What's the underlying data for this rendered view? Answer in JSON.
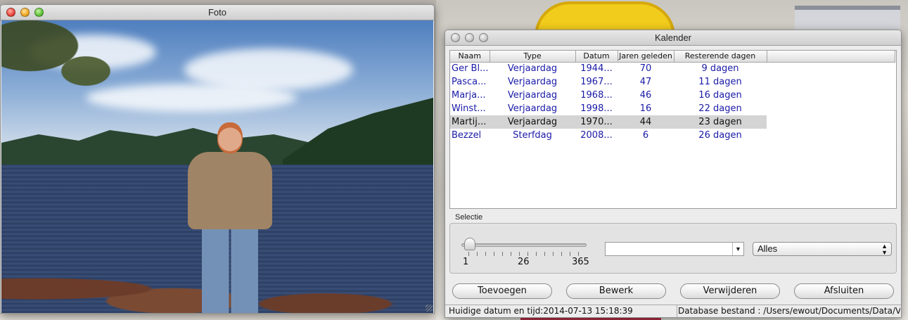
{
  "photo_window": {
    "title": "Foto"
  },
  "calendar_window": {
    "title": "Kalender",
    "columns": [
      "Naam",
      "Type",
      "Datum",
      "Jaren geleden",
      "Resterende dagen"
    ],
    "rows": [
      {
        "naam": "Ger Bl...",
        "type": "Verjaardag",
        "datum": "1944...",
        "jaren": "70",
        "rest": "9 dagen"
      },
      {
        "naam": "Pasca...",
        "type": "Verjaardag",
        "datum": "1967...",
        "jaren": "47",
        "rest": "11 dagen"
      },
      {
        "naam": "Marja...",
        "type": "Verjaardag",
        "datum": "1968...",
        "jaren": "46",
        "rest": "16 dagen"
      },
      {
        "naam": "Winst...",
        "type": "Verjaardag",
        "datum": "1998...",
        "jaren": "16",
        "rest": "22 dagen"
      },
      {
        "naam": "Martij...",
        "type": "Verjaardag",
        "datum": "1970...",
        "jaren": "44",
        "rest": "23 dagen"
      },
      {
        "naam": "Bezzel",
        "type": "Sterfdag",
        "datum": "2008...",
        "jaren": "6",
        "rest": "26 dagen"
      }
    ],
    "selected_row": 4,
    "selection": {
      "label": "Selectie",
      "slider_labels": [
        "1",
        "26",
        "365"
      ],
      "slider_value": 26,
      "combo_value": "",
      "popup_value": "Alles"
    },
    "buttons": {
      "add": "Toevoegen",
      "edit": "Bewerk",
      "delete": "Verwijderen",
      "close": "Afsluiten"
    },
    "status": {
      "left": "Huidige datum en tijd:2014-07-13 15:18:39",
      "right": "Database bestand : /Users/ewout/Documents/Data/Verjaardagen"
    }
  },
  "colors": {
    "row_text": "#1a1aa8",
    "selected_bg": "#d4d4d4"
  }
}
